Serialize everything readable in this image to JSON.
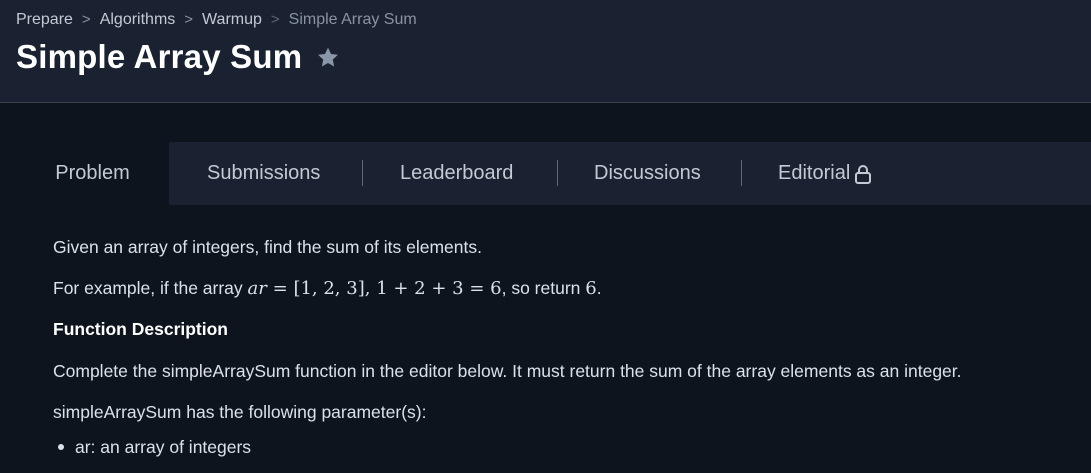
{
  "breadcrumb": {
    "items": [
      "Prepare",
      "Algorithms",
      "Warmup"
    ],
    "current": "Simple Array Sum",
    "separator": ">"
  },
  "title": "Simple Array Sum",
  "tabs": [
    "Problem",
    "Submissions",
    "Leaderboard",
    "Discussions",
    "Editorial"
  ],
  "problem": {
    "intro": "Given an array of integers, find the sum of its elements.",
    "example_prefix": "For example, if the array",
    "example_var": "ar",
    "example_eq": "=",
    "example_array": "[1, 2, 3]",
    "example_comma": ",",
    "example_sum": "1 + 2 + 3 = 6",
    "example_mid": ", so return",
    "example_result": "6",
    "example_end": ".",
    "function_heading": "Function Description",
    "function_desc": "Complete the simpleArraySum function in the editor below. It must return the sum of the array elements as an integer.",
    "params_heading": "simpleArraySum has the following parameter(s):",
    "params": [
      "ar: an array of integers"
    ]
  },
  "colors": {
    "header_bg": "#1a2130",
    "page_bg": "#0e141e",
    "star": "#8a97a8"
  },
  "icons": [
    "star-icon",
    "lock-icon"
  ]
}
